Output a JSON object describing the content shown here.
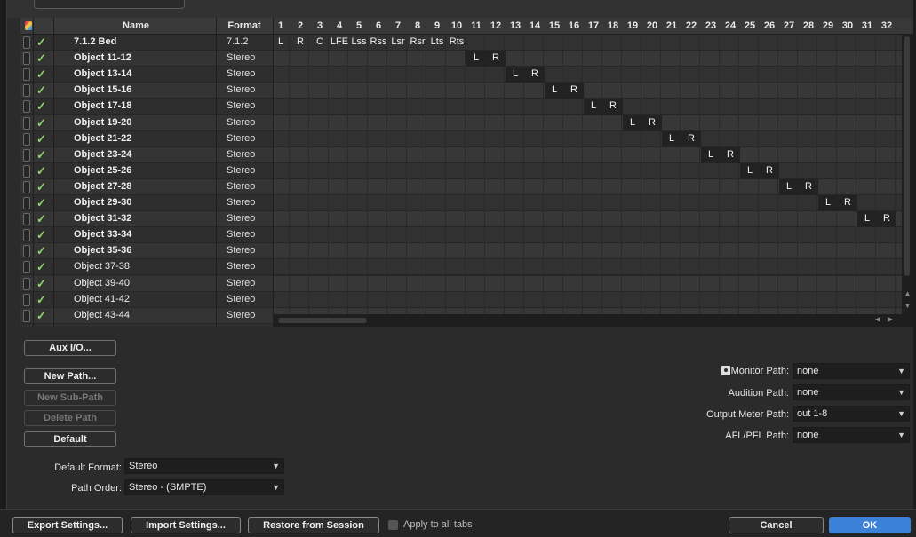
{
  "table": {
    "headers": {
      "name": "Name",
      "format": "Format"
    },
    "rows": [
      {
        "name": "7.1.2 Bed",
        "format": "7.1.2",
        "bold": true
      },
      {
        "name": "Object 11-12",
        "format": "Stereo",
        "bold": true
      },
      {
        "name": "Object 13-14",
        "format": "Stereo",
        "bold": true
      },
      {
        "name": "Object 15-16",
        "format": "Stereo",
        "bold": true
      },
      {
        "name": "Object 17-18",
        "format": "Stereo",
        "bold": true
      },
      {
        "name": "Object 19-20",
        "format": "Stereo",
        "bold": true
      },
      {
        "name": "Object 21-22",
        "format": "Stereo",
        "bold": true
      },
      {
        "name": "Object 23-24",
        "format": "Stereo",
        "bold": true
      },
      {
        "name": "Object 25-26",
        "format": "Stereo",
        "bold": true
      },
      {
        "name": "Object 27-28",
        "format": "Stereo",
        "bold": true
      },
      {
        "name": "Object 29-30",
        "format": "Stereo",
        "bold": true
      },
      {
        "name": "Object 31-32",
        "format": "Stereo",
        "bold": true
      },
      {
        "name": "Object 33-34",
        "format": "Stereo",
        "bold": true
      },
      {
        "name": "Object 35-36",
        "format": "Stereo",
        "bold": true
      },
      {
        "name": "Object 37-38",
        "format": "Stereo",
        "bold": false
      },
      {
        "name": "Object 39-40",
        "format": "Stereo",
        "bold": false
      },
      {
        "name": "Object 41-42",
        "format": "Stereo",
        "bold": false
      },
      {
        "name": "Object 43-44",
        "format": "Stereo",
        "bold": false
      }
    ]
  },
  "channels": [
    "1",
    "2",
    "3",
    "4",
    "5",
    "6",
    "7",
    "8",
    "9",
    "10",
    "11",
    "12",
    "13",
    "14",
    "15",
    "16",
    "17",
    "18",
    "19",
    "20",
    "21",
    "22",
    "23",
    "24",
    "25",
    "26",
    "27",
    "28",
    "29",
    "30",
    "31",
    "32"
  ],
  "assignments": [
    [
      "L",
      "R",
      "C",
      "LFE",
      "Lss",
      "Rss",
      "Lsr",
      "Rsr",
      "Lts",
      "Rts"
    ],
    [
      "L",
      "R"
    ],
    [
      "L",
      "R"
    ],
    [
      "L",
      "R"
    ],
    [
      "L",
      "R"
    ],
    [
      "L",
      "R"
    ],
    [
      "L",
      "R"
    ],
    [
      "L",
      "R"
    ],
    [
      "L",
      "R"
    ],
    [
      "L",
      "R"
    ],
    [
      "L",
      "R"
    ],
    [
      "L",
      "R"
    ]
  ],
  "assignment_start_channels": [
    1,
    11,
    13,
    15,
    17,
    19,
    21,
    23,
    25,
    27,
    29,
    31
  ],
  "buttons": {
    "aux_io": "Aux I/O...",
    "new_path": "New Path...",
    "new_sub_path": "New Sub-Path",
    "delete_path": "Delete Path",
    "default": "Default"
  },
  "fields": {
    "default_format_label": "Default Format:",
    "default_format_value": "Stereo",
    "path_order_label": "Path Order:",
    "path_order_value": "Stereo - (SMPTE)",
    "monitor_path_label": "Monitor Path:",
    "monitor_path_value": "none",
    "audition_path_label": "Audition Path:",
    "audition_path_value": "none",
    "output_meter_label": "Output Meter Path:",
    "output_meter_value": "out 1-8",
    "afl_pfl_label": "AFL/PFL Path:",
    "afl_pfl_value": "none"
  },
  "footer": {
    "export": "Export Settings...",
    "import": "Import Settings...",
    "restore": "Restore from Session",
    "apply_all": "Apply to all tabs",
    "cancel": "Cancel",
    "ok": "OK"
  },
  "colors": {
    "accent": "#3b82d8",
    "check": "#8fd36a"
  },
  "icons": {
    "check": "✓",
    "dropdown": "▼",
    "scroll_up": "▲",
    "scroll_down": "▼",
    "scroll_left": "◀",
    "scroll_right": "▶"
  }
}
